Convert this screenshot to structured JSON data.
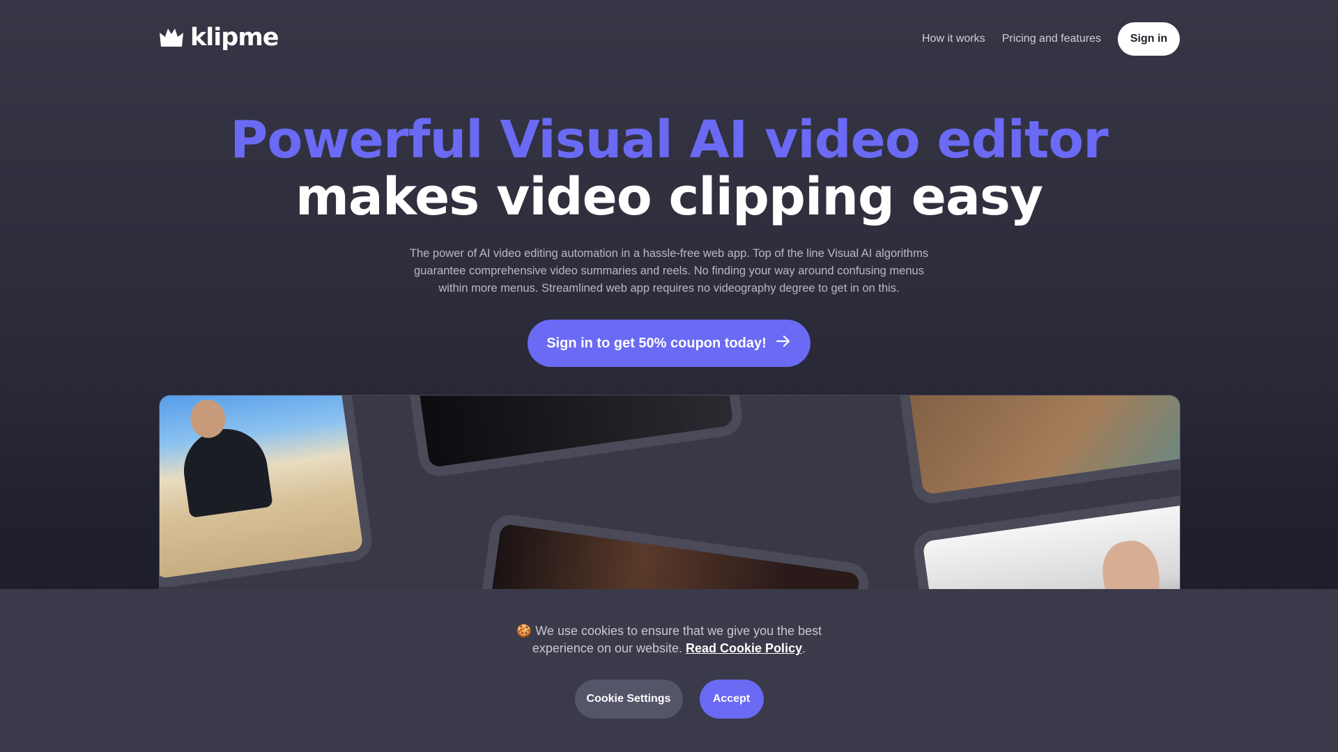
{
  "header": {
    "logo_text": "klipme",
    "logo_icon": "crown-icon",
    "nav": [
      {
        "label": "How it works"
      },
      {
        "label": "Pricing and features"
      }
    ],
    "signin_label": "Sign in"
  },
  "hero": {
    "title_line1": "Powerful Visual AI video editor",
    "title_line2": "makes video clipping easy",
    "description_lines": [
      "The power of AI video editing automation in a hassle-free web app. Top of the line Visual AI algorithms",
      "guarantee comprehensive video summaries and reels. No finding your way around confusing menus",
      "within more menus. Streamlined web app requires no videography degree to get in on this."
    ],
    "cta_label": "Sign in to get 50% coupon today!",
    "cta_icon": "arrow-right-icon"
  },
  "cookie": {
    "icon": "cookie-icon",
    "emoji": "🍪",
    "text_line1": "We use cookies to ensure that we give you the best",
    "text_line2": "experience on our website.",
    "link_label": "Read Cookie Policy",
    "trailing": ".",
    "settings_label": "Cookie Settings",
    "accept_label": "Accept"
  },
  "colors": {
    "accent": "#6a6af4",
    "background": "#2c2c3b",
    "cookie_bar": "#3a3a4a"
  }
}
